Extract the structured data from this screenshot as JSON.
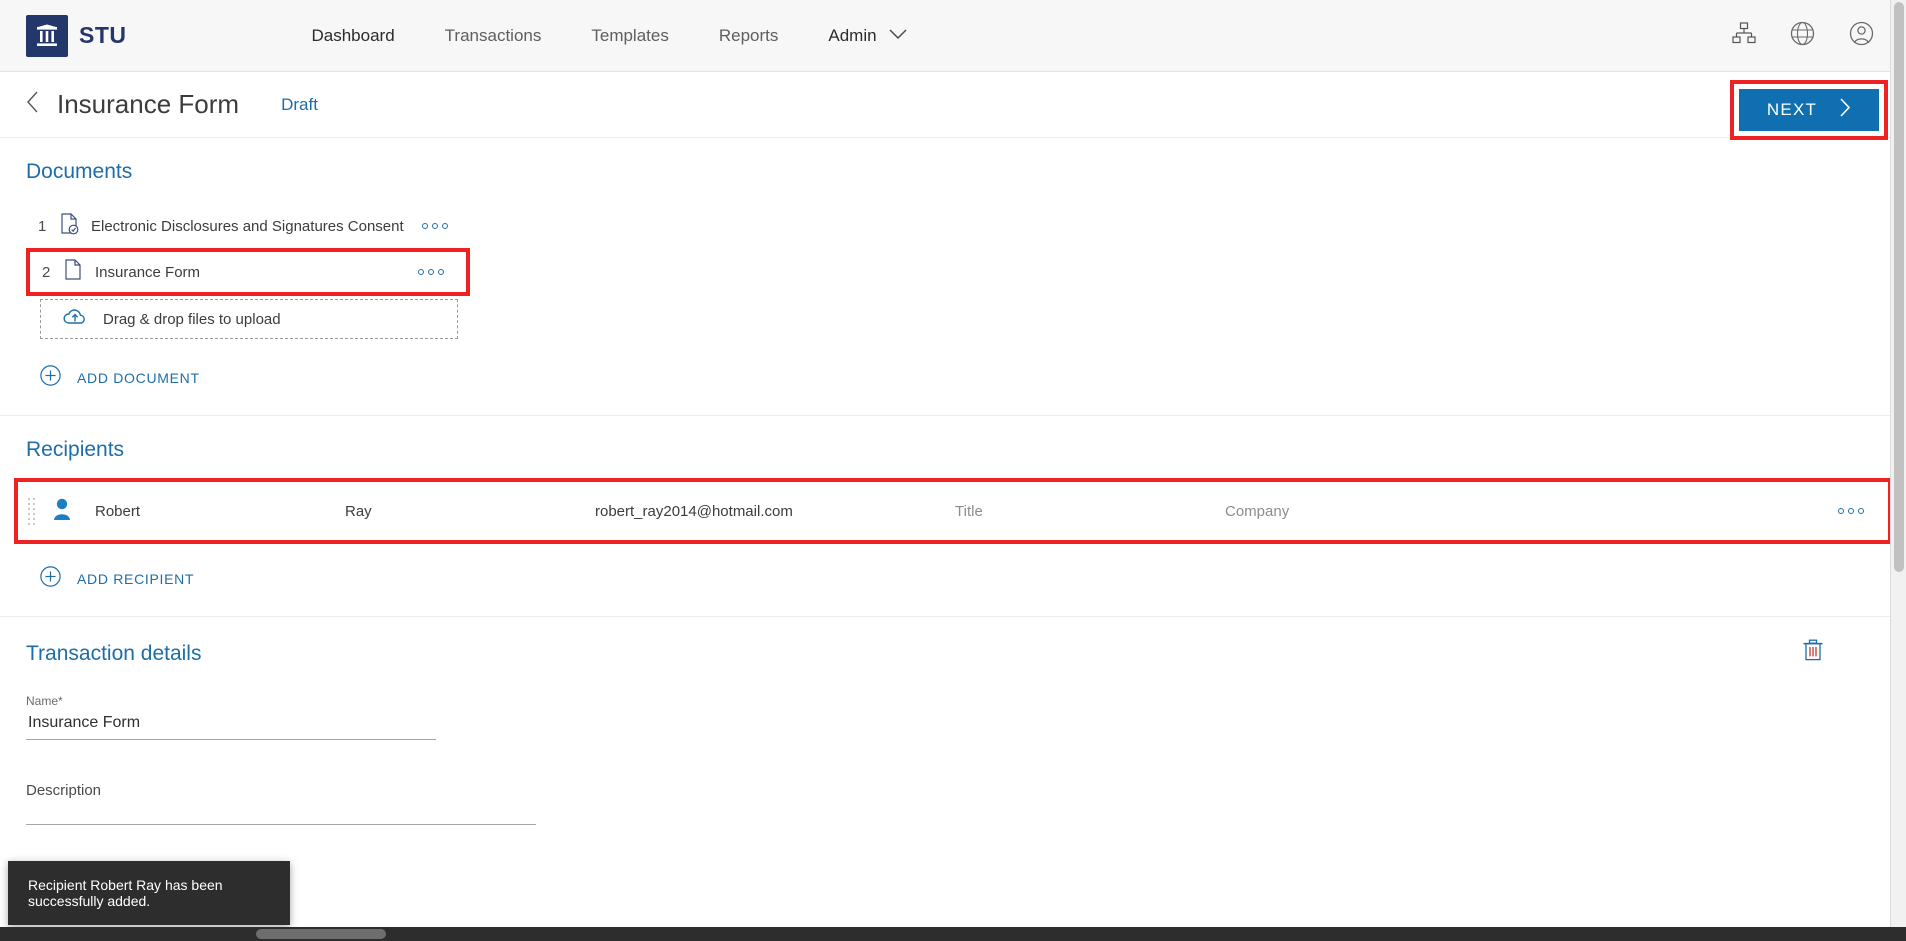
{
  "topnav": {
    "brand_name": "STU",
    "brand_icon": "bank-column-icon",
    "links": [
      {
        "label": "Dashboard",
        "active": true
      },
      {
        "label": "Transactions",
        "active": false
      },
      {
        "label": "Templates",
        "active": false
      },
      {
        "label": "Reports",
        "active": false
      }
    ],
    "admin_label": "Admin",
    "admin_chevron": "chevron-down-icon",
    "icons": [
      {
        "name": "sitemap-icon"
      },
      {
        "name": "globe-icon"
      },
      {
        "name": "user-account-icon"
      }
    ]
  },
  "page_header": {
    "back_icon": "chevron-left-icon",
    "title": "Insurance Form",
    "status": "Draft",
    "next_label": "NEXT",
    "next_icon": "chevron-right-icon"
  },
  "documents": {
    "section_title": "Documents",
    "items": [
      {
        "number": "1",
        "name": "Electronic Disclosures and Signatures Consent",
        "icon": "document-check-icon",
        "highlighted": false
      },
      {
        "number": "2",
        "name": "Insurance Form",
        "icon": "document-icon",
        "highlighted": true
      }
    ],
    "dropzone_label": "Drag & drop files to upload",
    "dropzone_icon": "cloud-upload-icon",
    "add_label": "ADD DOCUMENT",
    "add_icon": "plus-circle-icon"
  },
  "recipients": {
    "section_title": "Recipients",
    "rows": [
      {
        "first_name": "Robert",
        "last_name": "Ray",
        "email": "robert_ray2014@hotmail.com",
        "title_placeholder": "Title",
        "company_placeholder": "Company",
        "icon": "person-icon",
        "highlighted": true
      }
    ],
    "add_label": "ADD RECIPIENT",
    "add_icon": "plus-circle-icon"
  },
  "transaction_details": {
    "section_title": "Transaction details",
    "delete_icon": "trash-icon",
    "name_label": "Name",
    "name_required_marker": "*",
    "name_value": "Insurance Form",
    "description_label": "Description",
    "description_value": ""
  },
  "toast": {
    "message": "Recipient Robert Ray has been successfully added."
  },
  "colors": {
    "brand_navy": "#24376b",
    "accent_blue": "#1d6ea8",
    "primary_button": "#0f6fb0",
    "annotation_red": "#ee2222",
    "toast_bg": "#2d2d2d"
  }
}
